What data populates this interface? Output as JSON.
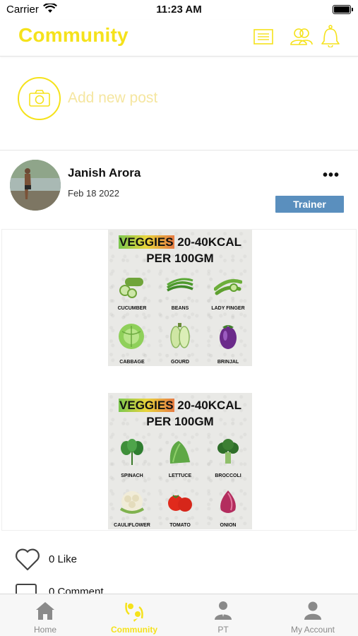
{
  "status_bar": {
    "carrier": "Carrier",
    "time": "11:23 AM"
  },
  "header": {
    "title": "Community",
    "icons": [
      "news-icon",
      "people-icon",
      "bell-icon"
    ]
  },
  "add_post": {
    "label": "Add new post"
  },
  "post": {
    "author": "Janish Arora",
    "date": "Feb 18 2022",
    "badge": "Trainer",
    "more": "•••",
    "cards": [
      {
        "title_highlight": "VEGGIES",
        "title_rest": "20-40KCAL",
        "title_line2": "PER 100GM",
        "items": [
          "CUCUMBER",
          "BEANS",
          "LADY FINGER",
          "CABBAGE",
          "GOURD",
          "BRINJAL"
        ]
      },
      {
        "title_highlight": "VEGGIES",
        "title_rest": "20-40KCAL",
        "title_line2": "PER 100GM",
        "items": [
          "SPINACH",
          "LETTUCE",
          "BROCCOLI",
          "CAULIFLOWER",
          "TOMATO",
          "ONION"
        ]
      }
    ],
    "likes_label": "0 Like",
    "comments_label": "0 Comment"
  },
  "tabs": [
    {
      "label": "Home",
      "icon": "home-icon",
      "active": false
    },
    {
      "label": "Community",
      "icon": "community-icon",
      "active": true
    },
    {
      "label": "PT",
      "icon": "trainer-icon",
      "active": false
    },
    {
      "label": "My Account",
      "icon": "user-icon",
      "active": false
    }
  ],
  "colors": {
    "accent": "#f5e21b",
    "badge": "#5a8fbe",
    "tab_inactive": "#8a8a8a"
  }
}
